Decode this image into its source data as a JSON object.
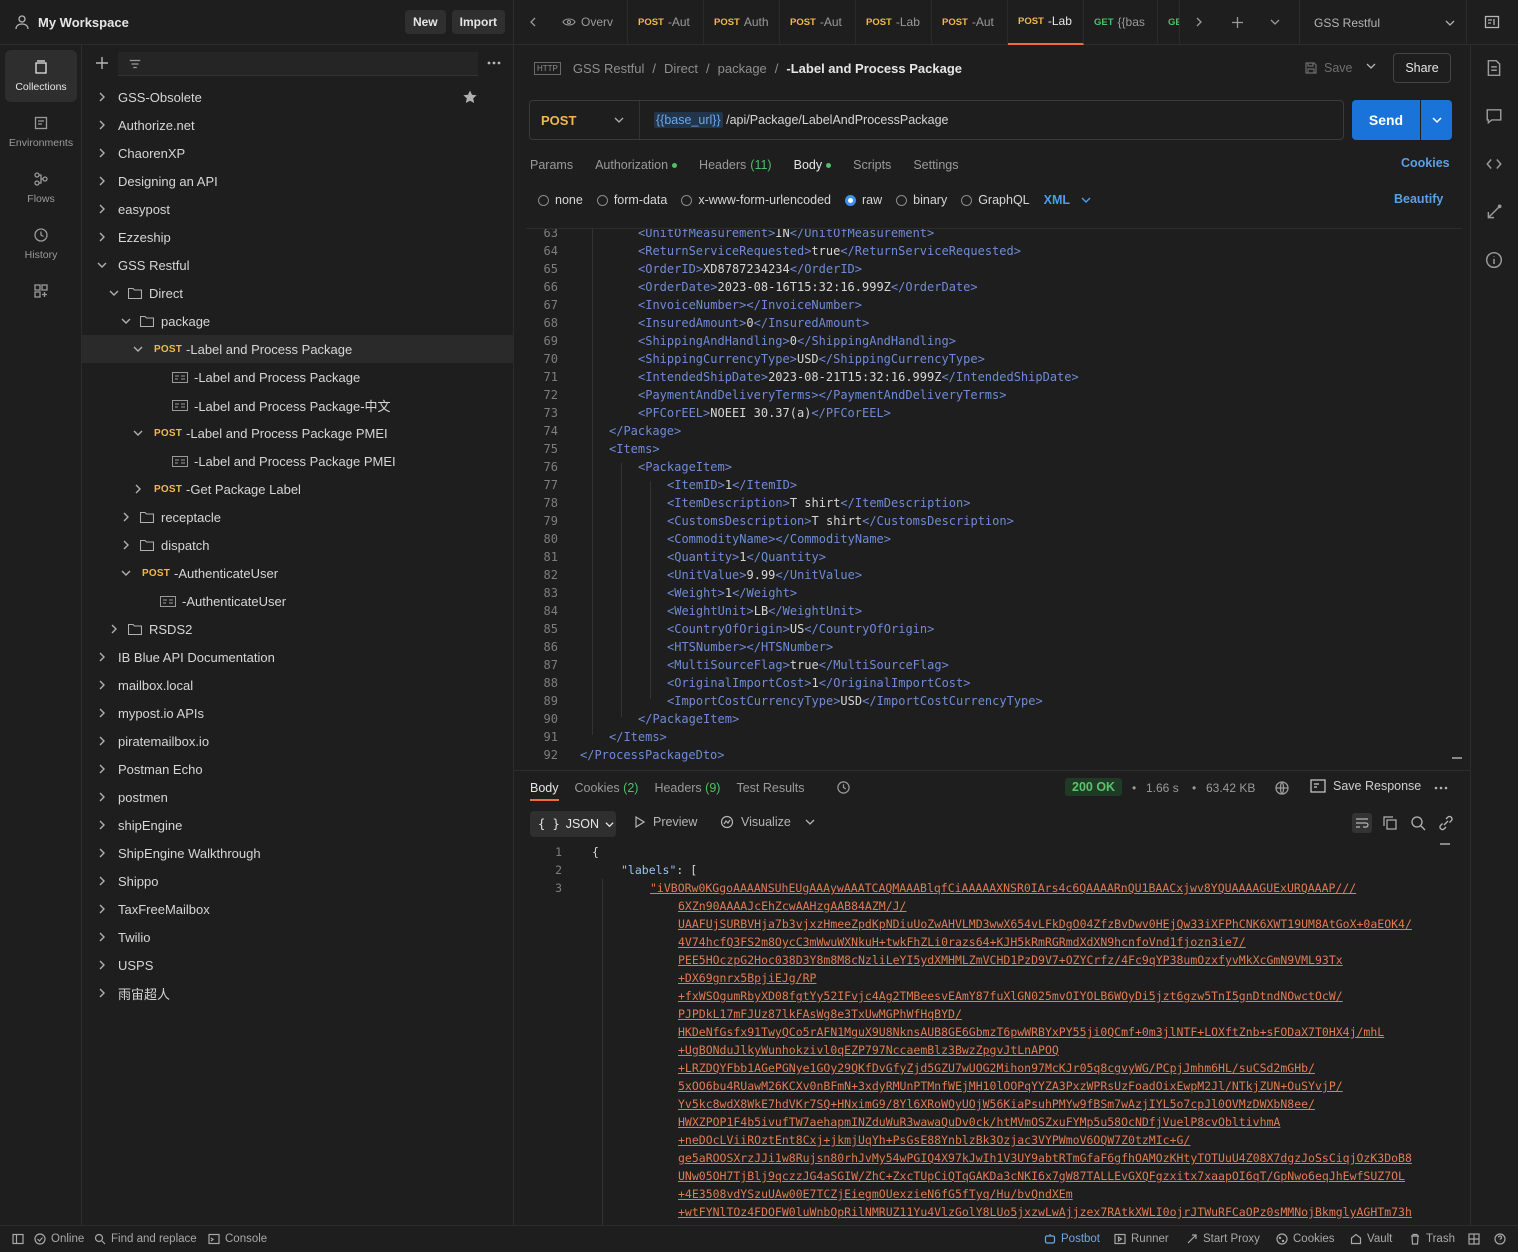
{
  "workspace": {
    "name": "My Workspace",
    "new_label": "New",
    "import_label": "Import"
  },
  "rail": [
    {
      "label": "Collections",
      "icon": "collections-icon"
    },
    {
      "label": "Environments",
      "icon": "environments-icon"
    },
    {
      "label": "Flows",
      "icon": "flows-icon"
    },
    {
      "label": "History",
      "icon": "history-icon"
    }
  ],
  "tree": [
    {
      "label": "GSS-Obsolete",
      "depth": 0,
      "type": "collection",
      "chevron": "right",
      "starred": true
    },
    {
      "label": "Authorize.net",
      "depth": 0,
      "type": "collection",
      "chevron": "right"
    },
    {
      "label": "ChaorenXP",
      "depth": 0,
      "type": "collection",
      "chevron": "right"
    },
    {
      "label": "Designing an API",
      "depth": 0,
      "type": "collection",
      "chevron": "right"
    },
    {
      "label": "easypost",
      "depth": 0,
      "type": "collection",
      "chevron": "right"
    },
    {
      "label": "Ezzeship",
      "depth": 0,
      "type": "collection",
      "chevron": "right"
    },
    {
      "label": "GSS Restful",
      "depth": 0,
      "type": "collection",
      "chevron": "down"
    },
    {
      "label": "Direct",
      "depth": 1,
      "type": "folder",
      "chevron": "down"
    },
    {
      "label": "package",
      "depth": 2,
      "type": "folder",
      "chevron": "down"
    },
    {
      "label": "-Label and Process Package",
      "depth": 3,
      "type": "request",
      "method": "POST",
      "chevron": "down",
      "selected": true
    },
    {
      "label": "-Label and Process Package",
      "depth": 4,
      "type": "example"
    },
    {
      "label": "-Label and Process Package-中文",
      "depth": 4,
      "type": "example"
    },
    {
      "label": "-Label and Process Package PMEI",
      "depth": 3,
      "type": "request",
      "method": "POST",
      "chevron": "down"
    },
    {
      "label": "-Label and Process Package PMEI",
      "depth": 4,
      "type": "example"
    },
    {
      "label": "-Get Package Label",
      "depth": 3,
      "type": "request",
      "method": "POST",
      "chevron": "right"
    },
    {
      "label": "receptacle",
      "depth": 2,
      "type": "folder",
      "chevron": "right"
    },
    {
      "label": "dispatch",
      "depth": 2,
      "type": "folder",
      "chevron": "right"
    },
    {
      "label": "-AuthenticateUser",
      "depth": 2,
      "type": "request",
      "method": "POST",
      "chevron": "down"
    },
    {
      "label": "-AuthenticateUser",
      "depth": 3,
      "type": "example"
    },
    {
      "label": "RSDS2",
      "depth": 1,
      "type": "folder",
      "chevron": "right"
    },
    {
      "label": "IB Blue API Documentation",
      "depth": 0,
      "type": "collection",
      "chevron": "right"
    },
    {
      "label": "mailbox.local",
      "depth": 0,
      "type": "collection",
      "chevron": "right"
    },
    {
      "label": "mypost.io APIs",
      "depth": 0,
      "type": "collection",
      "chevron": "right"
    },
    {
      "label": "piratemailbox.io",
      "depth": 0,
      "type": "collection",
      "chevron": "right"
    },
    {
      "label": "Postman Echo",
      "depth": 0,
      "type": "collection",
      "chevron": "right"
    },
    {
      "label": "postmen",
      "depth": 0,
      "type": "collection",
      "chevron": "right"
    },
    {
      "label": "shipEngine",
      "depth": 0,
      "type": "collection",
      "chevron": "right"
    },
    {
      "label": "ShipEngine Walkthrough",
      "depth": 0,
      "type": "collection",
      "chevron": "right"
    },
    {
      "label": "Shippo",
      "depth": 0,
      "type": "collection",
      "chevron": "right"
    },
    {
      "label": "TaxFreeMailbox",
      "depth": 0,
      "type": "collection",
      "chevron": "right"
    },
    {
      "label": "Twilio",
      "depth": 0,
      "type": "collection",
      "chevron": "right"
    },
    {
      "label": "USPS",
      "depth": 0,
      "type": "collection",
      "chevron": "right"
    },
    {
      "label": "雨宙超人",
      "depth": 0,
      "type": "collection",
      "chevron": "right"
    }
  ],
  "tabs": [
    {
      "method": "",
      "label": "Overv",
      "icon": "overview-icon"
    },
    {
      "method": "POST",
      "label": "-Aut"
    },
    {
      "method": "POST",
      "label": "Auth"
    },
    {
      "method": "POST",
      "label": "-Aut"
    },
    {
      "method": "POST",
      "label": "-Lab"
    },
    {
      "method": "POST",
      "label": "-Aut"
    },
    {
      "method": "POST",
      "label": "-Lab",
      "active": true
    },
    {
      "method": "GET",
      "label": "{{bas",
      "dot": true
    },
    {
      "method": "GE",
      "label": ""
    }
  ],
  "environment": "GSS Restful",
  "breadcrumb": {
    "http": "HTTP",
    "parts": [
      "GSS Restful",
      "Direct",
      "package"
    ],
    "current": "-Label and Process Package"
  },
  "save_label": "Save",
  "share_label": "Share",
  "request": {
    "method": "POST",
    "url_var": "{{base_url}}",
    "url_path": " /api/Package/LabelAndProcessPackage",
    "send_label": "Send"
  },
  "req_tabs": [
    {
      "label": "Params"
    },
    {
      "label": "Authorization",
      "dot": true
    },
    {
      "label": "Headers",
      "count": "(11)"
    },
    {
      "label": "Body",
      "dot": true,
      "active": true
    },
    {
      "label": "Scripts"
    },
    {
      "label": "Settings"
    }
  ],
  "cookies_label": "Cookies",
  "body_types": [
    "none",
    "form-data",
    "x-www-form-urlencoded",
    "raw",
    "binary",
    "GraphQL"
  ],
  "body_type_selected": "raw",
  "body_format": "XML",
  "beautify_label": "Beautify",
  "code_lines": [
    {
      "n": "63",
      "indent": 2,
      "tag": "UnitOfMeasurement",
      "value": "IN"
    },
    {
      "n": "64",
      "indent": 2,
      "tag": "ReturnServiceRequested",
      "value": "true"
    },
    {
      "n": "65",
      "indent": 2,
      "tag": "OrderID",
      "value": "XD8787234234"
    },
    {
      "n": "66",
      "indent": 2,
      "tag": "OrderDate",
      "value": "2023-08-16T15:32:16.999Z"
    },
    {
      "n": "67",
      "indent": 2,
      "tag": "InvoiceNumber",
      "value": ""
    },
    {
      "n": "68",
      "indent": 2,
      "tag": "InsuredAmount",
      "value": "0"
    },
    {
      "n": "69",
      "indent": 2,
      "tag": "ShippingAndHandling",
      "value": "0"
    },
    {
      "n": "70",
      "indent": 2,
      "tag": "ShippingCurrencyType",
      "value": "USD"
    },
    {
      "n": "71",
      "indent": 2,
      "tag": "IntendedShipDate",
      "value": "2023-08-21T15:32:16.999Z"
    },
    {
      "n": "72",
      "indent": 2,
      "tag": "PaymentAndDeliveryTerms",
      "value": ""
    },
    {
      "n": "73",
      "indent": 2,
      "tag": "PFCorEEL",
      "value": "NOEEI 30.37(a)"
    },
    {
      "n": "74",
      "indent": 1,
      "close": "Package"
    },
    {
      "n": "75",
      "indent": 1,
      "open": "Items"
    },
    {
      "n": "76",
      "indent": 2,
      "open": "PackageItem"
    },
    {
      "n": "77",
      "indent": 3,
      "tag": "ItemID",
      "value": "1"
    },
    {
      "n": "78",
      "indent": 3,
      "tag": "ItemDescription",
      "value": "T shirt"
    },
    {
      "n": "79",
      "indent": 3,
      "tag": "CustomsDescription",
      "value": "T shirt"
    },
    {
      "n": "80",
      "indent": 3,
      "tag": "CommodityName",
      "value": ""
    },
    {
      "n": "81",
      "indent": 3,
      "tag": "Quantity",
      "value": "1"
    },
    {
      "n": "82",
      "indent": 3,
      "tag": "UnitValue",
      "value": "9.99"
    },
    {
      "n": "83",
      "indent": 3,
      "tag": "Weight",
      "value": "1"
    },
    {
      "n": "84",
      "indent": 3,
      "tag": "WeightUnit",
      "value": "LB"
    },
    {
      "n": "85",
      "indent": 3,
      "tag": "CountryOfOrigin",
      "value": "US"
    },
    {
      "n": "86",
      "indent": 3,
      "tag": "HTSNumber",
      "value": ""
    },
    {
      "n": "87",
      "indent": 3,
      "tag": "MultiSourceFlag",
      "value": "true"
    },
    {
      "n": "88",
      "indent": 3,
      "tag": "OriginalImportCost",
      "value": "1"
    },
    {
      "n": "89",
      "indent": 3,
      "tag": "ImportCostCurrencyType",
      "value": "USD"
    },
    {
      "n": "90",
      "indent": 2,
      "close": "PackageItem"
    },
    {
      "n": "91",
      "indent": 1,
      "close": "Items"
    },
    {
      "n": "92",
      "indent": 0,
      "close": "ProcessPackageDto"
    }
  ],
  "resp_tabs": [
    {
      "label": "Body",
      "active": true
    },
    {
      "label": "Cookies",
      "count": "(2)"
    },
    {
      "label": "Headers",
      "count": "(9)"
    },
    {
      "label": "Test Results"
    }
  ],
  "response": {
    "status": "200 OK",
    "time": "1.66 s",
    "size": "63.42 KB",
    "save_label": "Save Response",
    "format": "JSON",
    "preview_label": "Preview",
    "visualize_label": "Visualize"
  },
  "json_lines": [
    {
      "n": "1",
      "text": "{"
    },
    {
      "n": "2",
      "key": "\"labels\"",
      "text": ": ["
    },
    {
      "n": "3",
      "str": "\"iVBORw0KGgoAAAANSUhEUgAAAywAAATCAQMAAABlqfCiAAAAAXNSR0IArs4c6QAAAARnQU1BAACxjwv8YQUAAAAGUExURQAAAP///"
    },
    {
      "n": "",
      "str": "6XZn90AAAAJcEhZcwAAHzgAAB84AZM/J/"
    },
    {
      "n": "",
      "str": "UAAFUjSURBVHja7b3vjxzHmeeZpdKpNDiuUoZwAHVLMD3wwX654vLFkDgO04ZfzBvDwv0HEjQw33iXFPhCNK6XWT19UM8AtGoX+0aEOK4/"
    },
    {
      "n": "",
      "str": "4V74hcfQ3FS2m8OycC3mWwuWXNkuH+twkFhZLi0razs64+KJH5kRmRGRmdXdXN9hcnfoVnd1fjozn3ie7/"
    },
    {
      "n": "",
      "str": "PEE5HOczpG2Hoc038D3Y8m8M8cNzliLeYI5ydXMHMLZmVCHD1PzD9V7+OZYCrfz/4Fc9qYP38umOzxfyvMkXcGmN9VML93Tx"
    },
    {
      "n": "",
      "str": "+DX69gnrx5BpjiEJg/RP"
    },
    {
      "n": "",
      "str": "+fxWSOgumRbyXD08fgtYy52IFvjc4Ag2TMBeesvEAmY87fuXlGN025mvOIYOLB6WOyDi5jzt6gzw5TnI5gnDtndNOwctOcW/"
    },
    {
      "n": "",
      "str": "PJPDkL17mFJUz87lkFAsWg8e3TxUwMGPhWfHqBYD/"
    },
    {
      "n": "",
      "str": "HKDeNfGsfx91TwyQCo5rAFN1MguX9U8NknsAUB8GE6GbmzT6pwWRBYxPY55ji0QCmf+0m3jlNTF+LOXftZnb+sFODaX7T0HX4j/mhL"
    },
    {
      "n": "",
      "str": "+UgBONduJlkyWunhokzivl0qEZP797NccaemBlz3BwzZpgvJtLnAPOQ"
    },
    {
      "n": "",
      "str": "+LRZDQYFbb1AGePGNye1GOy29QKfDvGfyZjd5GZU7wUOG2Mihon97McKJr05q8cgvyWG/PCpjJmhm6HL/suCSd2mGHb/"
    },
    {
      "n": "",
      "str": "5xOO6bu4RUawM26KCXv0nBFmN+3xdyRMUnPTMnfWEjMH10lOOPqYYZA3PxzWPRsUzFoadOixEwpM2Jl/NTkjZUN+OuSYvjP/"
    },
    {
      "n": "",
      "str": "Yv5kc8wdX8WkE7hdVKr7SQ+HNximG9/8Yl6XRoWOyUOjW56KiaPsuhPMYw9fBSm7wAzjIYL5o7cpJl0OVMzDWXbN8ee/"
    },
    {
      "n": "",
      "str": "HWXZPOP1F4b5ivufTW7aehapmINZduWuR3wawaQuDv0ck/htMVmOSZxuFYMp5u58OcNDfjVuelP8cvObltivhmA"
    },
    {
      "n": "",
      "str": "+neDOcLViiROztEnt8Cxj+jkmjUqYh+PsGsE88YnblzBk3Ozjac3VYPWmoV6OQW7Z0tzMIc+G/"
    },
    {
      "n": "",
      "str": "ge5aROOSXrzJJi1w8Rujsn80rhJvMy54wPGIQ4X97kJwIh1V3UY9abtRTmGfaF6gfhOAMOzKHtyTOTUuU4Z08X7dgzJoSsCiqjOzK3DoB8"
    },
    {
      "n": "",
      "str": "UNw05OH7TjBlj9qczzJG4aSGIW/ZhC+ZxcTUpCiQTqGAKDa3cNKI6x7gW87TALLEvGXQFgzxitx7xaapOI6qT/GpNwo6eqJhEwfSUZ7OL"
    },
    {
      "n": "",
      "str": "+4E3508vdYSzuUAw00E7TCZjEiegmOUexzieN6fG5fTyq/Hu/bvQndXEm"
    },
    {
      "n": "",
      "str": "+wtFYNlTOz4FDOFW0luWnbOpRilNMRUZ11Yu4VlzGolY8LUo5jxzwLwAjjzex7RAtkXWLI0ojrJTWuRFCaOPz0sMMNojBkmglyAGHTm73h"
    }
  ],
  "footer": {
    "online": "Online",
    "find_replace": "Find and replace",
    "console": "Console",
    "postbot": "Postbot",
    "runner": "Runner",
    "start_proxy": "Start Proxy",
    "cookies": "Cookies",
    "vault": "Vault",
    "trash": "Trash"
  }
}
